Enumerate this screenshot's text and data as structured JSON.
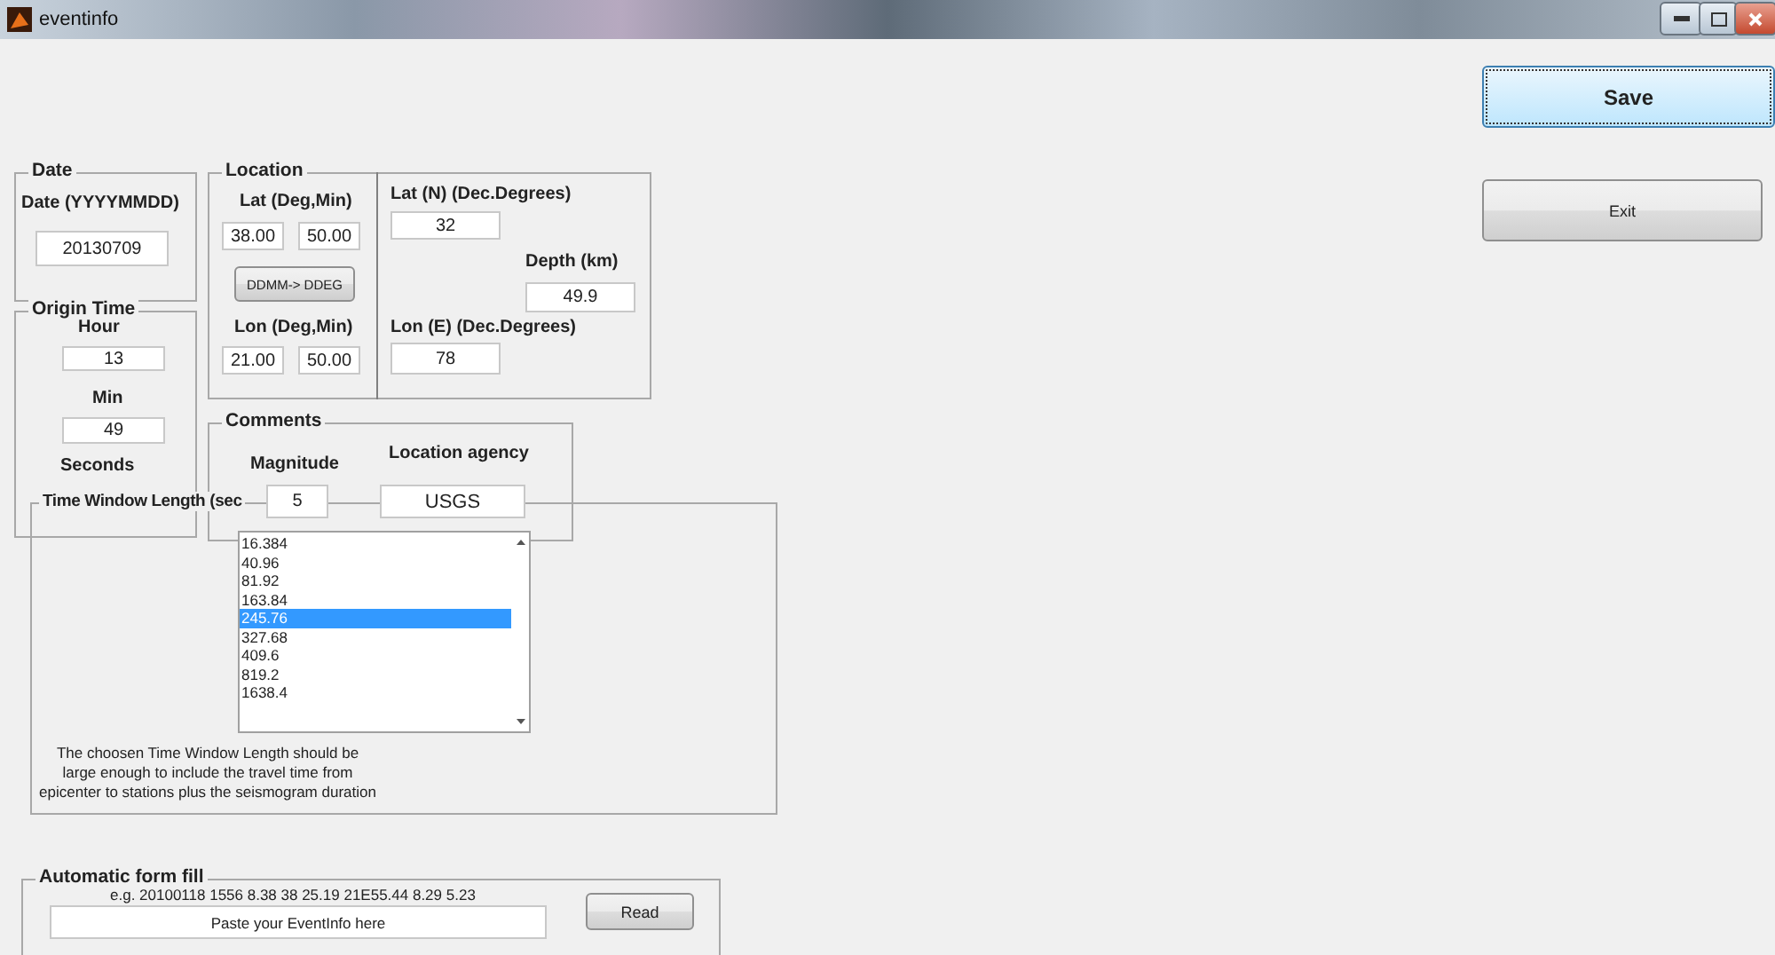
{
  "window": {
    "title": "eventinfo"
  },
  "date": {
    "title": "Date",
    "label": "Date  (YYYYMMDD)",
    "value": "20130709"
  },
  "origin_time": {
    "title": "Origin Time",
    "hour_label": "Hour",
    "hour": "13",
    "min_label": "Min",
    "min": "49",
    "seconds_label": "Seconds"
  },
  "location": {
    "title": "Location",
    "lat_label": "Lat (Deg,Min)",
    "lat_deg": "38.00",
    "lat_min": "50.00",
    "convert_button": "DDMM-> DDEG",
    "lon_label": "Lon (Deg,Min)",
    "lon_deg": "21.00",
    "lon_min": "50.00",
    "lat_dec_label": "Lat (N)  (Dec.Degrees)",
    "lat_dec": "32",
    "depth_label": "Depth  (km)",
    "depth": "49.9",
    "lon_dec_label": "Lon (E) (Dec.Degrees)",
    "lon_dec": "78"
  },
  "comments": {
    "title": "Comments",
    "magnitude_label": "Magnitude",
    "magnitude": "5",
    "agency_label": "Location agency",
    "agency": "USGS"
  },
  "time_window": {
    "title": "Time Window Length (sec",
    "options": [
      {
        "label": "16.384",
        "selected": false
      },
      {
        "label": "40.96",
        "selected": false
      },
      {
        "label": "81.92",
        "selected": false
      },
      {
        "label": "163.84",
        "selected": false
      },
      {
        "label": "245.76",
        "selected": true
      },
      {
        "label": "327.68",
        "selected": false
      },
      {
        "label": "409.6",
        "selected": false
      },
      {
        "label": "819.2",
        "selected": false
      },
      {
        "label": "1638.4",
        "selected": false
      }
    ],
    "note": "The choosen Time Window Length should be large enough to include the travel time from epicenter to stations plus the seismogram duration"
  },
  "auto_fill": {
    "title": "Automatic form fill",
    "example": "e.g. 20100118 1556  8.38 38 25.19  21E55.44   8.29   5.23",
    "placeholder": "Paste your EventInfo here",
    "button": "Read"
  },
  "buttons": {
    "save": "Save",
    "exit": "Exit"
  }
}
